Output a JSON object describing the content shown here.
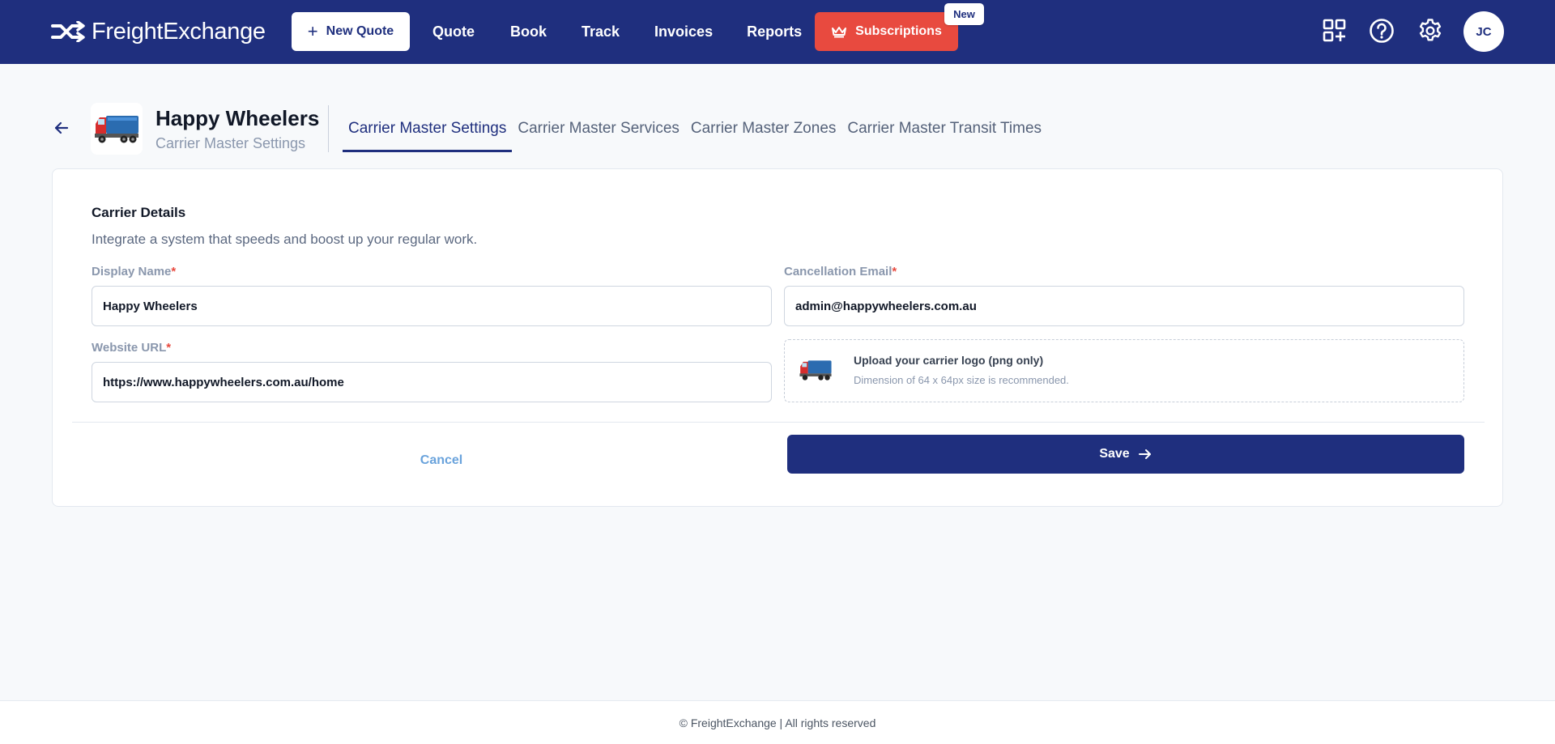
{
  "app": {
    "brand": "FreightExchange"
  },
  "nav": {
    "new_quote_label": "New Quote",
    "links": [
      "Quote",
      "Book",
      "Track",
      "Invoices",
      "Reports"
    ],
    "subscriptions_label": "Subscriptions",
    "new_badge": "New",
    "avatar_initials": "JC"
  },
  "header": {
    "carrier_name": "Happy Wheelers",
    "carrier_subtitle": "Carrier Master Settings",
    "tabs": [
      {
        "label": "Carrier Master Settings",
        "active": true
      },
      {
        "label": "Carrier Master Services",
        "active": false
      },
      {
        "label": "Carrier Master Zones",
        "active": false
      },
      {
        "label": "Carrier Master Transit Times",
        "active": false
      }
    ]
  },
  "form": {
    "section_title": "Carrier Details",
    "section_description": "Integrate a system that speeds and boost up your regular work.",
    "display_name_label": "Display Name",
    "display_name_value": "Happy Wheelers",
    "cancellation_email_label": "Cancellation Email",
    "cancellation_email_value": "admin@happywheelers.com.au",
    "website_url_label": "Website URL",
    "website_url_value": "https://www.happywheelers.com.au/home",
    "required_mark": "*",
    "upload_title": "Upload your carrier logo (png only)",
    "upload_hint": "Dimension of 64 x 64px size is recommended.",
    "cancel_label": "Cancel",
    "save_label": "Save"
  },
  "footer": {
    "text": "© FreightExchange | All rights reserved"
  },
  "colors": {
    "primary": "#1f2f7e",
    "accent_red": "#e84a3f",
    "link_blue": "#6aa3dc"
  }
}
